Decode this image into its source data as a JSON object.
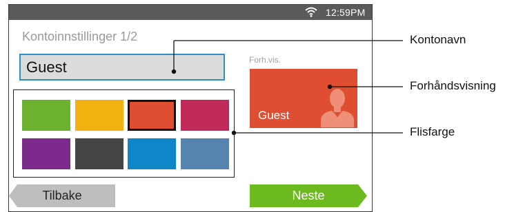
{
  "status_bar": {
    "time": "12:59PM",
    "wifi_icon": "wifi-icon"
  },
  "screen": {
    "title": "Kontoinnstillinger 1/2",
    "account_name": {
      "value": "Guest"
    },
    "preview": {
      "label": "Forh.vis.",
      "tile_name": "Guest",
      "tile_color": "#e04e32",
      "avatar_icon": "person-icon"
    },
    "tile_colors": [
      {
        "name": "green",
        "color": "#6db22e",
        "selected": false
      },
      {
        "name": "amber",
        "color": "#f2b011",
        "selected": false
      },
      {
        "name": "orange-red",
        "color": "#e04e32",
        "selected": true
      },
      {
        "name": "magenta",
        "color": "#bf2a58",
        "selected": false
      },
      {
        "name": "purple",
        "color": "#7c2a8c",
        "selected": false
      },
      {
        "name": "dark-gray",
        "color": "#444444",
        "selected": false
      },
      {
        "name": "blue",
        "color": "#0e86c8",
        "selected": false
      },
      {
        "name": "steel-blue",
        "color": "#5683b0",
        "selected": false
      }
    ],
    "buttons": {
      "back": "Tilbake",
      "next": "Neste",
      "back_color": "#bebebe",
      "next_color": "#6dba20"
    }
  },
  "callouts": {
    "account_name": "Kontonavn",
    "preview": "Forhåndsvisning",
    "tile_color": "Flisfarge"
  }
}
